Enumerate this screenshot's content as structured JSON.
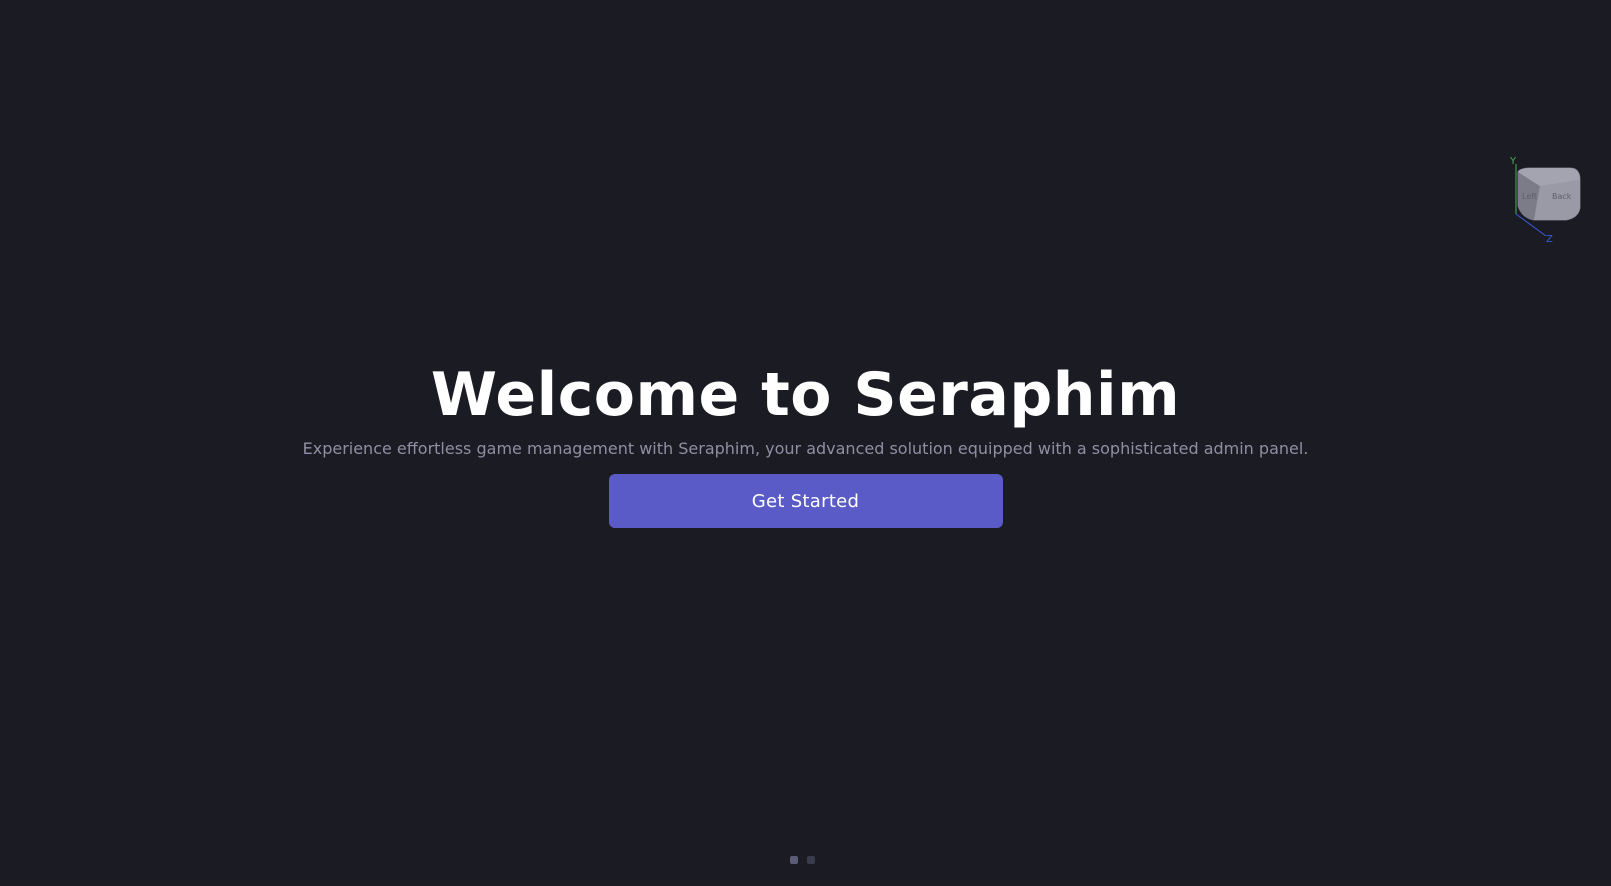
{
  "hero": {
    "title": "Welcome to Seraphim",
    "subtitle": "Experience effortless game management with Seraphim, your advanced solution equipped with a sophisticated admin panel.",
    "cta_label": "Get Started"
  },
  "view_gizmo": {
    "axis_labels": {
      "y": "Y",
      "z": "Z"
    },
    "face_labels": [
      "Left",
      "Back"
    ],
    "icon": "orientation-cube-icon"
  },
  "pager": {
    "count": 2,
    "active_index": 0
  },
  "colors": {
    "background": "#1b1b24",
    "accent": "#5a5bc7",
    "title": "#ffffff",
    "subtitle": "#8f8fa3",
    "axis_y": "#4caf50",
    "axis_z": "#3b5bdb"
  }
}
